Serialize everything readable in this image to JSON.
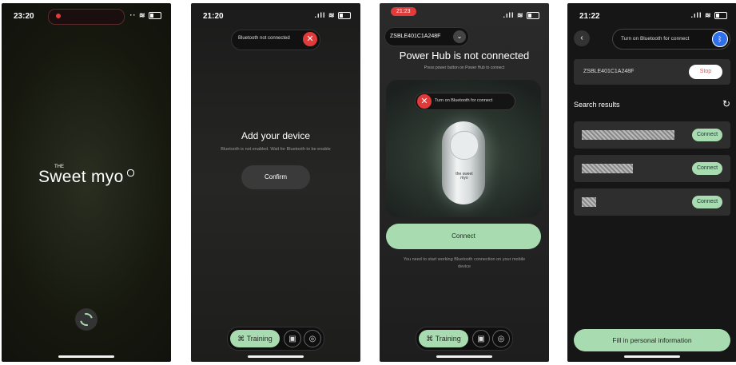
{
  "screen1": {
    "time": "23:20",
    "brand_the": "THE",
    "brand_name": "Sweet myo",
    "status_right": "·· ⋮ ▮"
  },
  "screen2": {
    "time": "21:20",
    "bt_banner": "Bluetooth not connected",
    "heading": "Add your device",
    "subtitle": "Bluetooth is not enabled. Wait for Bluetooth to be enable",
    "confirm": "Confirm",
    "tab_training": "Training"
  },
  "screen3": {
    "time": "21:23",
    "device_id": "ZSBLE401C1A248F",
    "heading": "Power Hub is not connected",
    "subtitle": "Press power button on Power Hub to connect",
    "bt_banner": "Turn on Bluetooth for connect",
    "device_label": "the sweet myo",
    "connect": "Connect",
    "note": "You need to start working Bluetooth connection on your mobile device",
    "tab_training": "Training"
  },
  "screen4": {
    "time": "21:22",
    "bt_banner": "Turn on Bluetooth for connect",
    "device_id": "ZSBLE401C1A248F",
    "stop": "Stop",
    "search_results": "Search results",
    "results": [
      {
        "connect": "Connect"
      },
      {
        "connect": "Connect"
      },
      {
        "connect": "Connect"
      }
    ],
    "fill_info": "Fill in personal information"
  },
  "colors": {
    "accent_green": "#a8dcb0",
    "bt_red": "#e03a3a",
    "bt_blue": "#2f6fe8",
    "stop_red": "#e05555"
  }
}
